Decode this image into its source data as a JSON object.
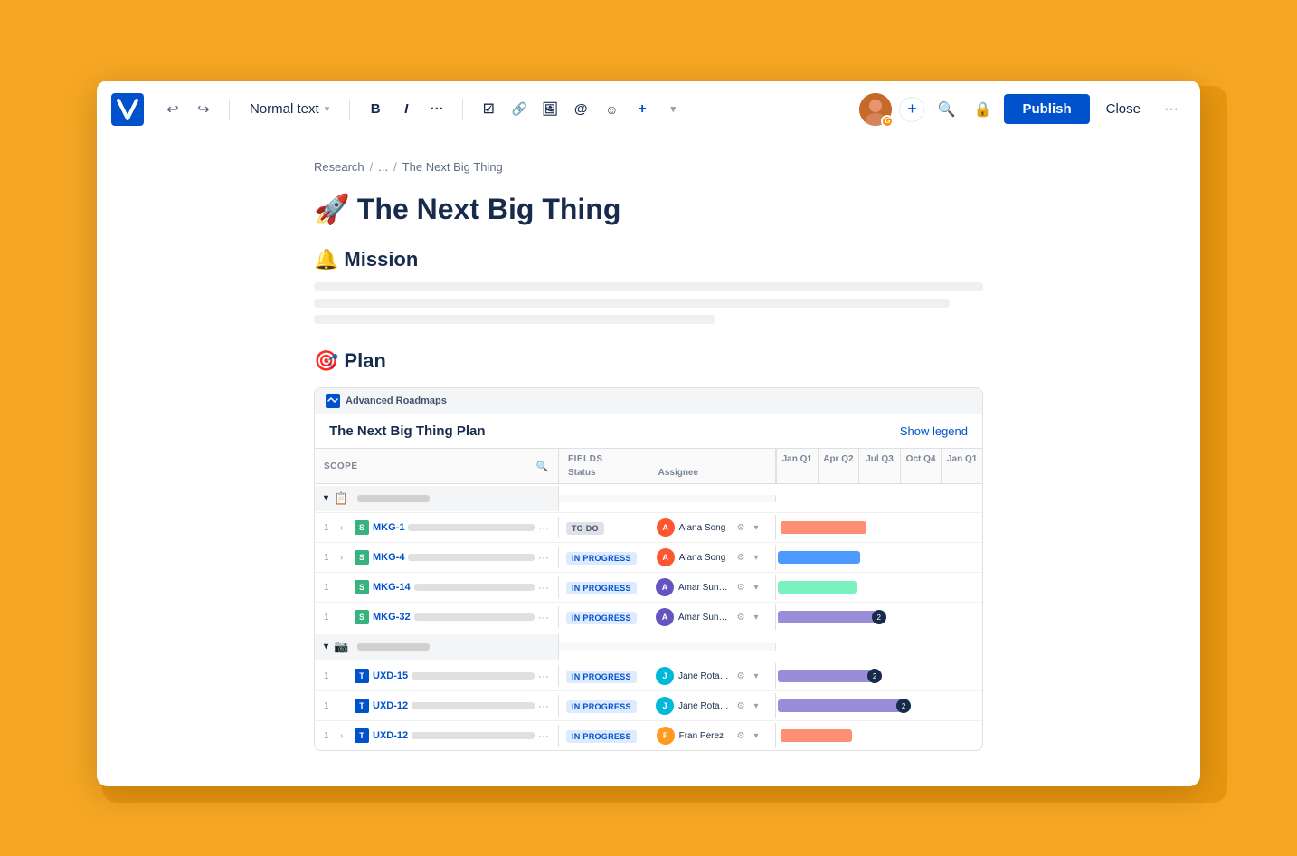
{
  "window": {
    "title": "The Next Big Thing"
  },
  "toolbar": {
    "undo_label": "↩",
    "redo_label": "↪",
    "text_style_label": "Normal text",
    "bold_label": "B",
    "italic_label": "I",
    "more_label": "···",
    "checkbox_label": "☑",
    "link_label": "🔗",
    "image_label": "🖼",
    "mention_label": "@",
    "emoji_label": "☺",
    "insert_label": "+",
    "search_label": "🔍",
    "lock_label": "🔒",
    "publish_label": "Publish",
    "close_label": "Close",
    "more_options_label": "···",
    "avatar_initials": "G"
  },
  "breadcrumb": {
    "items": [
      "Research",
      "...",
      "The Next Big Thing"
    ],
    "separators": [
      "/",
      "/"
    ]
  },
  "page": {
    "title_emoji": "🚀",
    "title": "The Next Big Thing",
    "mission_emoji": "🔔",
    "mission_title": "Mission",
    "plan_emoji": "🎯",
    "plan_title": "Plan",
    "placeholder_lines": [
      {
        "width": "100%"
      },
      {
        "width": "95%"
      },
      {
        "width": "60%"
      }
    ]
  },
  "roadmap": {
    "brand_label": "Advanced Roadmaps",
    "title": "The Next Big Thing Plan",
    "show_legend_label": "Show legend",
    "columns": {
      "scope_label": "SCOPE",
      "fields_label": "FIELDS",
      "status_sub": "Status",
      "assignee_sub": "Assignee",
      "quarters": [
        "Jan Q1",
        "Apr Q2",
        "Jul Q3",
        "Oct Q4",
        "Jan Q1"
      ]
    },
    "rows": [
      {
        "type": "group",
        "icon": "📋",
        "name_placeholder": true,
        "chevron": "▾"
      },
      {
        "type": "item",
        "number": "1",
        "expand": "›",
        "badge_color": "story",
        "key": "MKG-1",
        "status": "TO DO",
        "status_type": "todo",
        "assignee": "Alana Song",
        "assignee_color": "av-alana",
        "bar_color": "bar-pink",
        "bar_left": "2%",
        "bar_width": "42%",
        "bar_badge": null
      },
      {
        "type": "item",
        "number": "1",
        "expand": "›",
        "badge_color": "story",
        "key": "MKG-4",
        "status": "IN PROGRESS",
        "status_type": "inprogress",
        "assignee": "Alana Song",
        "assignee_color": "av-alana",
        "bar_color": "bar-blue",
        "bar_left": "1%",
        "bar_width": "40%",
        "bar_badge": null
      },
      {
        "type": "item",
        "number": "1",
        "expand": "",
        "badge_color": "story",
        "key": "MKG-14",
        "status": "IN PROGRESS",
        "status_type": "inprogress",
        "assignee": "Amar Sundaram",
        "assignee_color": "av-amar",
        "bar_color": "bar-green",
        "bar_left": "1%",
        "bar_width": "38%",
        "bar_badge": null
      },
      {
        "type": "item",
        "number": "1",
        "expand": "",
        "badge_color": "story",
        "key": "MKG-32",
        "status": "IN PROGRESS",
        "status_type": "inprogress",
        "assignee": "Amar Sundaram",
        "assignee_color": "av-amar",
        "bar_color": "bar-purple",
        "bar_left": "1%",
        "bar_width": "48%",
        "bar_badge": "2"
      },
      {
        "type": "group",
        "icon": "📷",
        "name_placeholder": true,
        "chevron": "▾"
      },
      {
        "type": "item",
        "number": "1",
        "expand": "",
        "badge_color": "task",
        "key": "UXD-15",
        "status": "IN PROGRESS",
        "status_type": "inprogress",
        "assignee": "Jane Rotanson",
        "assignee_color": "av-jane",
        "bar_color": "bar-purple",
        "bar_left": "1%",
        "bar_width": "46%",
        "bar_badge": "2"
      },
      {
        "type": "item",
        "number": "1",
        "expand": "",
        "badge_color": "task",
        "key": "UXD-12",
        "status": "IN PROGRESS",
        "status_type": "inprogress",
        "assignee": "Jane Rotanson",
        "assignee_color": "av-jane",
        "bar_color": "bar-purple",
        "bar_left": "1%",
        "bar_width": "60%",
        "bar_badge": "2"
      },
      {
        "type": "item",
        "number": "1",
        "expand": "›",
        "badge_color": "task",
        "key": "UXD-12",
        "status": "IN PROGRESS",
        "status_type": "inprogress",
        "assignee": "Fran Perez",
        "assignee_color": "av-fran",
        "bar_color": "bar-pink",
        "bar_left": "2%",
        "bar_width": "35%",
        "bar_badge": null
      }
    ]
  }
}
